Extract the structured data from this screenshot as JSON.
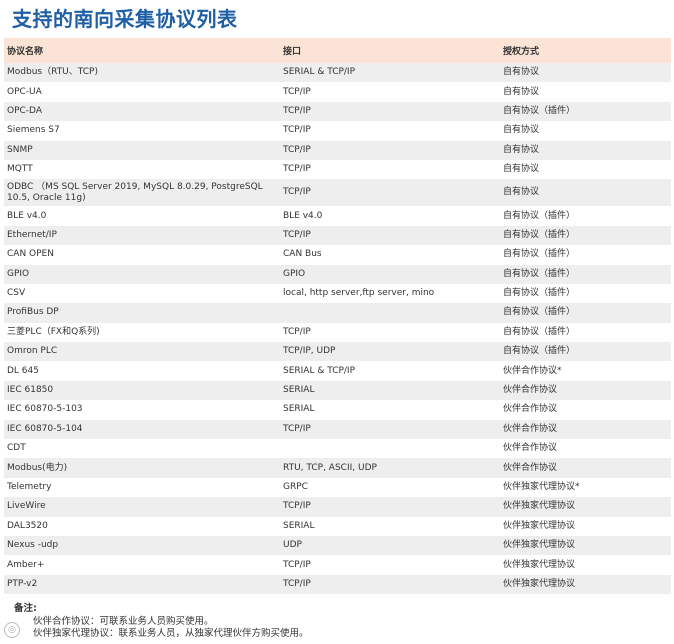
{
  "title": "支持的南向采集协议列表",
  "table": {
    "headers": [
      "协议名称",
      "接口",
      "授权方式"
    ],
    "rows": [
      {
        "name": "Modbus（RTU、TCP)",
        "interface": "SERIAL & TCP/IP",
        "license": "自有协议"
      },
      {
        "name": "OPC-UA",
        "interface": "TCP/IP",
        "license": "自有协议"
      },
      {
        "name": "OPC-DA",
        "interface": "TCP/IP",
        "license": "自有协议（插件）"
      },
      {
        "name": "Siemens S7",
        "interface": "TCP/IP",
        "license": "自有协议"
      },
      {
        "name": "SNMP",
        "interface": "TCP/IP",
        "license": "自有协议"
      },
      {
        "name": "MQTT",
        "interface": "TCP/IP",
        "license": "自有协议"
      },
      {
        "name": "ODBC （MS SQL Server 2019, MySQL 8.0.29, PostgreSQL 10.5, Oracle 11g)",
        "interface": "TCP/IP",
        "license": "自有协议"
      },
      {
        "name": "BLE v4.0",
        "interface": "BLE v4.0",
        "license": "自有协议（插件）"
      },
      {
        "name": "Ethernet/IP",
        "interface": "TCP/IP",
        "license": "自有协议（插件）"
      },
      {
        "name": "CAN OPEN",
        "interface": "CAN Bus",
        "license": "自有协议（插件）"
      },
      {
        "name": "GPIO",
        "interface": "GPIO",
        "license": "自有协议（插件）"
      },
      {
        "name": "CSV",
        "interface": "local, http server,ftp server, mino",
        "license": "自有协议（插件）"
      },
      {
        "name": "ProfiBus DP",
        "interface": "",
        "license": "自有协议（插件）"
      },
      {
        "name": "三菱PLC（FX和Q系列)",
        "interface": "TCP/IP",
        "license": "自有协议（插件）"
      },
      {
        "name": "Omron PLC",
        "interface": "TCP/IP, UDP",
        "license": "自有协议（插件）"
      },
      {
        "name": "DL 645",
        "interface": "SERIAL & TCP/IP",
        "license": "伙伴合作协议*"
      },
      {
        "name": "IEC 61850",
        "interface": "SERIAL",
        "license": "伙伴合作协议"
      },
      {
        "name": "IEC 60870-5-103",
        "interface": "SERIAL",
        "license": "伙伴合作协议"
      },
      {
        "name": "IEC 60870-5-104",
        "interface": "TCP/IP",
        "license": "伙伴合作协议"
      },
      {
        "name": "CDT",
        "interface": "",
        "license": "伙伴合作协议"
      },
      {
        "name": "Modbus(电力)",
        "interface": "RTU, TCP, ASCII, UDP",
        "license": "伙伴合作协议"
      },
      {
        "name": "Telemetry",
        "interface": "GRPC",
        "license": "伙伴独家代理协议*"
      },
      {
        "name": "LiveWire",
        "interface": "TCP/IP",
        "license": "伙伴独家代理协议"
      },
      {
        "name": "DAL3520",
        "interface": "SERIAL",
        "license": "伙伴独家代理协议"
      },
      {
        "name": "Nexus -udp",
        "interface": "UDP",
        "license": "伙伴独家代理协议"
      },
      {
        "name": "Amber+",
        "interface": "TCP/IP",
        "license": "伙伴独家代理协议"
      },
      {
        "name": "PTP-v2",
        "interface": "TCP/IP",
        "license": "伙伴独家代理协议"
      }
    ]
  },
  "notes": {
    "title": "备注:",
    "lines": [
      "伙伴合作协议：可联系业务人员购买使用。",
      "伙伴独家代理协议：联系业务人员，从独家代理伙伴方购买使用。"
    ]
  }
}
